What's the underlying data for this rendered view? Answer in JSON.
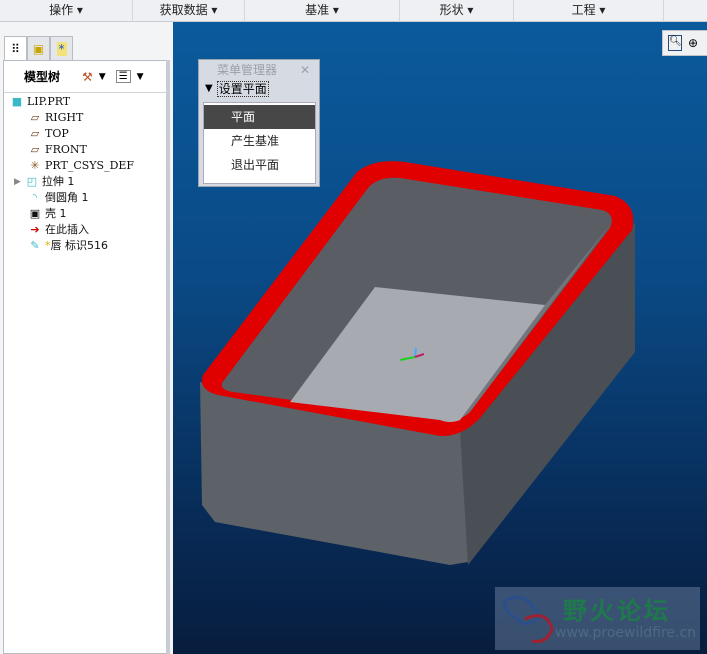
{
  "menubar": [
    "操作",
    "获取数据",
    "基准",
    "形状",
    "工程"
  ],
  "tree": {
    "title": "模型树",
    "items": [
      {
        "label": "LIP.PRT",
        "icon": "part-icon"
      },
      {
        "label": "RIGHT",
        "icon": "datum-plane-icon"
      },
      {
        "label": "TOP",
        "icon": "datum-plane-icon"
      },
      {
        "label": "FRONT",
        "icon": "datum-plane-icon"
      },
      {
        "label": "PRT_CSYS_DEF",
        "icon": "csys-icon"
      },
      {
        "label": "拉伸 1",
        "icon": "extrude-icon"
      },
      {
        "label": "倒圆角 1",
        "icon": "round-icon"
      },
      {
        "label": "壳 1",
        "icon": "shell-icon"
      },
      {
        "label": "在此插入",
        "icon": "insert-here-icon"
      },
      {
        "label": "唇 标识516",
        "icon": "lip-icon"
      }
    ]
  },
  "menu_manager": {
    "title": "菜单管理器",
    "section": "设置平面",
    "items": [
      "平面",
      "产生基准",
      "退出平面"
    ]
  },
  "watermark": {
    "title": "野火论坛",
    "url": "www.proewildfire.cn"
  },
  "colors": {
    "rim": "#e00000",
    "body": "#5c6068",
    "viewport": "#0a4a86"
  }
}
